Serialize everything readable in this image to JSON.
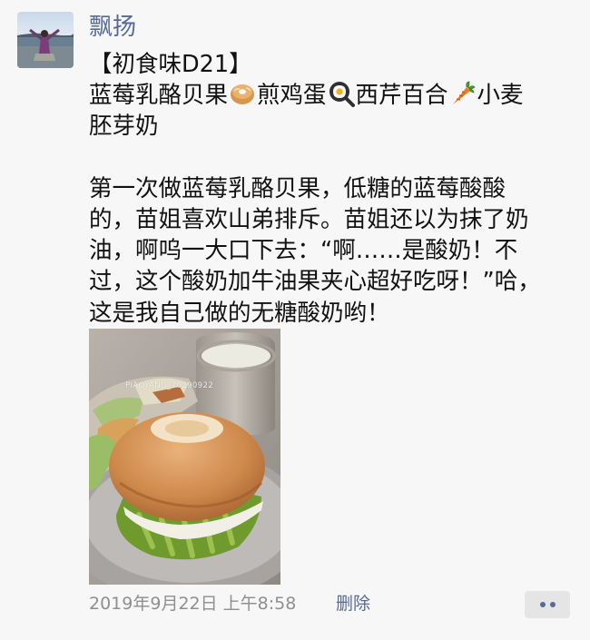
{
  "author": {
    "name": "飘扬"
  },
  "post": {
    "lines": [
      [
        "【初食味D21】"
      ],
      [
        "蓝莓乳酪贝果",
        "bagel-emoji",
        "煎鸡蛋",
        "fried-egg-emoji",
        "西芹百合",
        "carrot-emoji",
        "小麦"
      ],
      [
        "胚芽奶"
      ],
      [],
      [
        "第一次做蓝莓乳酪贝果，低糖的蓝莓酸酸"
      ],
      [
        "的，苗姐喜欢山弟排斥。苗姐还以为抹了奶"
      ],
      [
        "油，啊呜一大口下去：“啊……是酸奶！不"
      ],
      [
        "过，这个酸奶加牛油果夹心超好吃呀！”哈，"
      ],
      [
        "这是我自己做的无糖酸奶哟！"
      ]
    ],
    "photo": {
      "watermark": "PIAOYANG_20190922"
    }
  },
  "footer": {
    "timestamp": "2019年9月22日 上午8:58",
    "delete_label": "删除",
    "more_icon": "more-dots-icon"
  },
  "colors": {
    "link": "#576b95",
    "meta": "#8f8f8f",
    "background": "#f7f7f7",
    "more_button_bg": "#e5e5e5"
  }
}
